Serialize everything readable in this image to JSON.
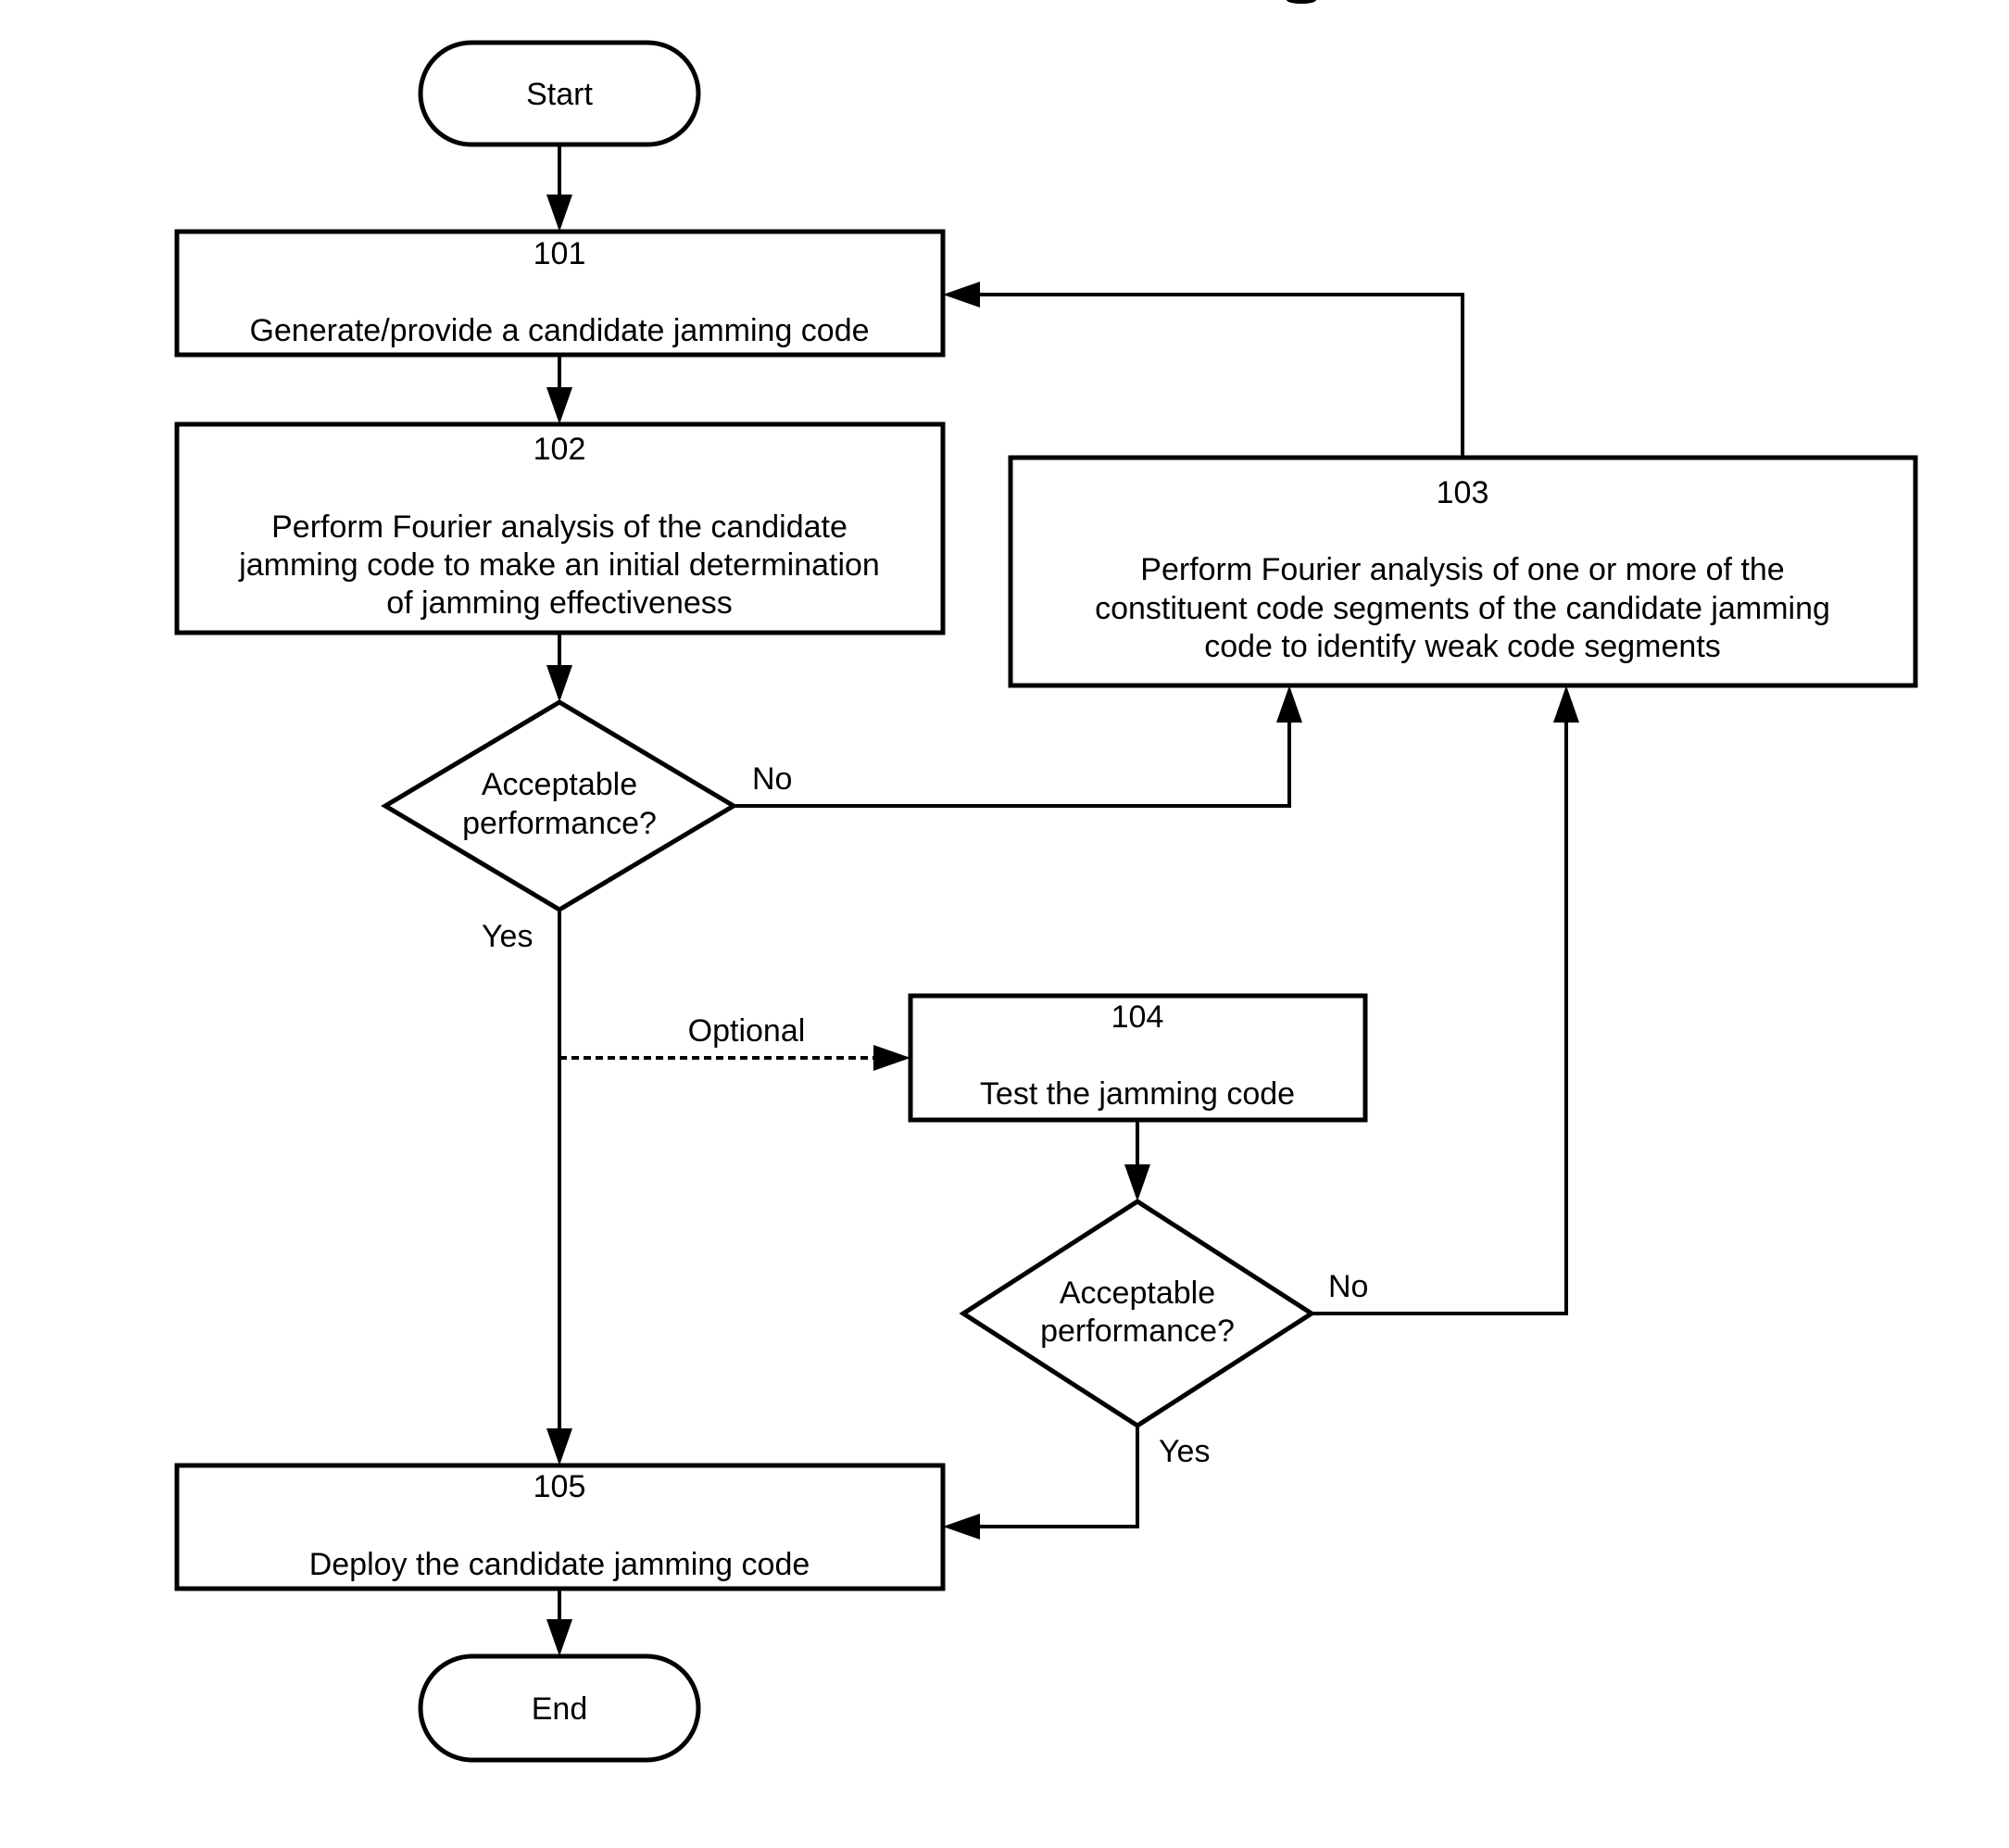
{
  "diagram": {
    "type": "flowchart",
    "start": {
      "label": "Start"
    },
    "end": {
      "label": "End"
    },
    "steps": [
      {
        "id": "101",
        "number": "101",
        "lines": [
          "Generate/provide a candidate jamming code"
        ]
      },
      {
        "id": "102",
        "number": "102",
        "lines": [
          "Perform Fourier analysis of the candidate",
          "jamming code to make an initial determination",
          "of jamming effectiveness"
        ]
      },
      {
        "id": "103",
        "number": "103",
        "lines": [
          "Perform Fourier analysis of one or more of the",
          "constituent code segments of the candidate jamming",
          "code to identify weak code segments"
        ]
      },
      {
        "id": "104",
        "number": "104",
        "lines": [
          "Test the jamming code"
        ]
      },
      {
        "id": "105",
        "number": "105",
        "lines": [
          "Deploy the candidate jamming code"
        ]
      }
    ],
    "decisions": [
      {
        "id": "decision-1",
        "lines": [
          "Acceptable",
          "performance?"
        ],
        "yes_label": "Yes",
        "no_label": "No"
      },
      {
        "id": "decision-2",
        "lines": [
          "Acceptable",
          "performance?"
        ],
        "yes_label": "Yes",
        "no_label": "No"
      }
    ],
    "optional_label": "Optional",
    "edges": [
      {
        "from": "Start",
        "to": "101"
      },
      {
        "from": "101",
        "to": "102"
      },
      {
        "from": "102",
        "to": "decision-1"
      },
      {
        "from": "decision-1",
        "to": "103",
        "label": "No"
      },
      {
        "from": "decision-1",
        "to": "105",
        "label": "Yes"
      },
      {
        "from": "decision-1-yes-branch",
        "to": "104",
        "label": "Optional",
        "style": "dashed"
      },
      {
        "from": "103",
        "to": "101"
      },
      {
        "from": "104",
        "to": "decision-2"
      },
      {
        "from": "decision-2",
        "to": "103",
        "label": "No"
      },
      {
        "from": "decision-2",
        "to": "105",
        "label": "Yes"
      },
      {
        "from": "105",
        "to": "End"
      }
    ]
  }
}
